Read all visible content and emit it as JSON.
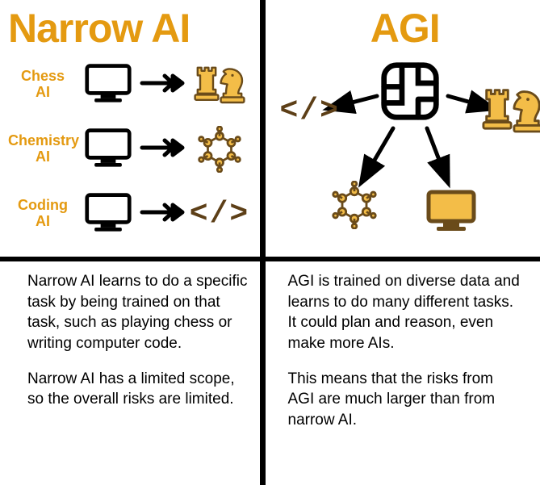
{
  "left": {
    "title": "Narrow AI",
    "rows": [
      {
        "label": "Chess\nAI",
        "iconName": "chess-icon"
      },
      {
        "label": "Chemistry\nAI",
        "iconName": "molecule-icon"
      },
      {
        "label": "Coding\nAI",
        "iconName": "code-icon"
      }
    ],
    "p1": "Narrow AI learns to do a specific task by being trained on that task, such as playing chess or writing computer code.",
    "p2": "Narrow AI has a limited scope, so the overall risks are limited."
  },
  "right": {
    "title": "AGI",
    "p1": "AGI is trained on diverse data and learns to do many different tasks. It could plan and reason, even make more AIs.",
    "p2": "This means that the risks from AGI are much larger than from narrow AI."
  },
  "colors": {
    "accent": "#e49a11",
    "brown": "#5d3f17",
    "fillYellow": "#f3bd48",
    "strokeBrown": "#6a4b1a"
  }
}
